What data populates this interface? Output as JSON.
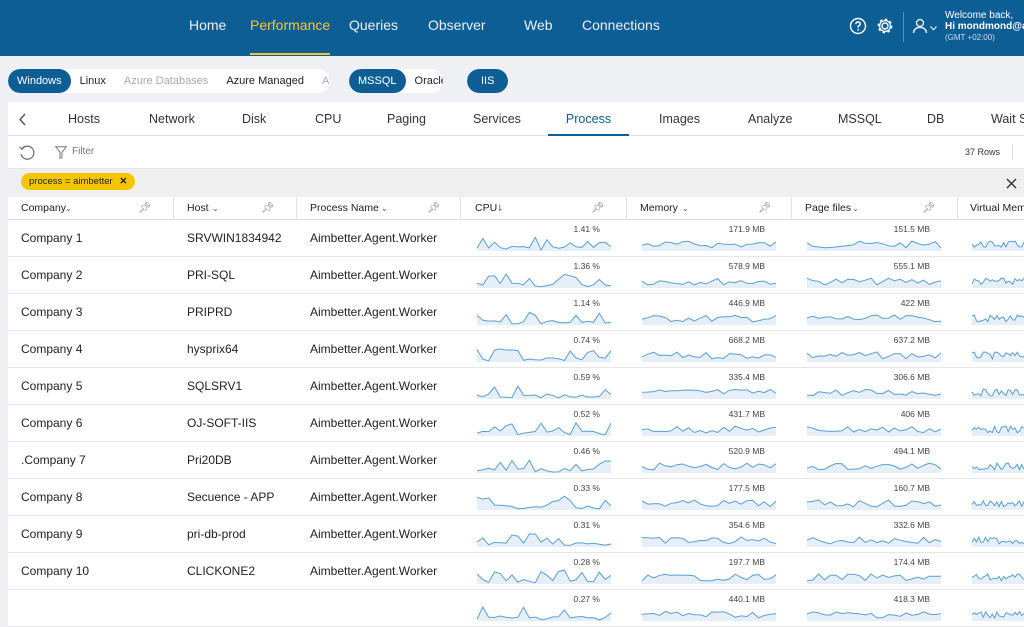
{
  "nav": {
    "items": [
      "Home",
      "Performance",
      "Queries",
      "Observer",
      "Web",
      "Connections"
    ],
    "active": "Performance"
  },
  "user": {
    "welcome": "Welcome back,",
    "name": "Hi mondmond@ai",
    "timezone": "(GMT +02:00)"
  },
  "platforms": [
    {
      "label": "Windows",
      "state": "selected"
    },
    {
      "label": "Linux",
      "state": "normal"
    },
    {
      "label": "Azure Databases",
      "state": "disabled"
    },
    {
      "label": "Azure Managed",
      "state": "normal"
    },
    {
      "label": "AWS",
      "state": "disabled"
    }
  ],
  "db_engines": [
    {
      "label": "MSSQL",
      "state": "selected"
    },
    {
      "label": "Oracle",
      "state": "normal"
    }
  ],
  "web_engines": [
    {
      "label": "IIS",
      "state": "selected"
    }
  ],
  "tabs": [
    "Hosts",
    "Network",
    "Disk",
    "CPU",
    "Paging",
    "Services",
    "Process",
    "Images",
    "Analyze",
    "MSSQL",
    "DB",
    "Wait S"
  ],
  "active_tab": "Process",
  "toolbar": {
    "filter_label": "Filter",
    "rows_label": "37 Rows"
  },
  "filter_chip": "process = aimbetter",
  "columns": [
    "Company",
    "Host",
    "Process Name",
    "CPU",
    "Memory",
    "Page files",
    "Virtual Mem"
  ],
  "rows": [
    {
      "company": "Company 1",
      "host": "SRVWIN1834942",
      "process": "Aimbetter.Agent.Worker",
      "cpu": "1.41 %",
      "memory": "171.9 MB",
      "pagefiles": "151.5 MB"
    },
    {
      "company": "Company  2",
      "host": "PRI-SQL",
      "process": "Aimbetter.Agent.Worker",
      "cpu": "1.36 %",
      "memory": "578.9 MB",
      "pagefiles": "555.1 MB"
    },
    {
      "company": "Company  3",
      "host": "PRIPRD",
      "process": "Aimbetter.Agent.Worker",
      "cpu": "1.14 %",
      "memory": "446.9 MB",
      "pagefiles": "422 MB"
    },
    {
      "company": "Company 4",
      "host": "hysprix64",
      "process": "Aimbetter.Agent.Worker",
      "cpu": "0.74 %",
      "memory": "668.2 MB",
      "pagefiles": "637.2 MB"
    },
    {
      "company": "Company  5",
      "host": "SQLSRV1",
      "process": "Aimbetter.Agent.Worker",
      "cpu": "0.59 %",
      "memory": "335.4 MB",
      "pagefiles": "306.6 MB"
    },
    {
      "company": "Company 6",
      "host": "OJ-SOFT-IIS",
      "process": "Aimbetter.Agent.Worker",
      "cpu": "0.52 %",
      "memory": "431.7 MB",
      "pagefiles": "406 MB"
    },
    {
      "company": ".Company 7",
      "host": "Pri20DB",
      "process": "Aimbetter.Agent.Worker",
      "cpu": "0.46 %",
      "memory": "520.9 MB",
      "pagefiles": "494.1 MB"
    },
    {
      "company": "Company  8",
      "host": "Secuence - APP",
      "process": "Aimbetter.Agent.Worker",
      "cpu": "0.33 %",
      "memory": "177.5 MB",
      "pagefiles": "160.7 MB"
    },
    {
      "company": "Company  9",
      "host": "pri-db-prod",
      "process": "Aimbetter.Agent.Worker",
      "cpu": "0.31 %",
      "memory": "354.6 MB",
      "pagefiles": "332.6 MB"
    },
    {
      "company": "Company  10",
      "host": "CLICKONE2",
      "process": "Aimbetter.Agent.Worker",
      "cpu": "0.28 %",
      "memory": "197.7 MB",
      "pagefiles": "174.4 MB"
    },
    {
      "company": "",
      "host": "",
      "process": "",
      "cpu": "0.27 %",
      "memory": "440.1 MB",
      "pagefiles": "418.3 MB"
    }
  ],
  "colors": {
    "brand": "#0e5e96",
    "accent": "#f4c531",
    "spark": "#5a9fd4",
    "chip": "#f5c600"
  }
}
